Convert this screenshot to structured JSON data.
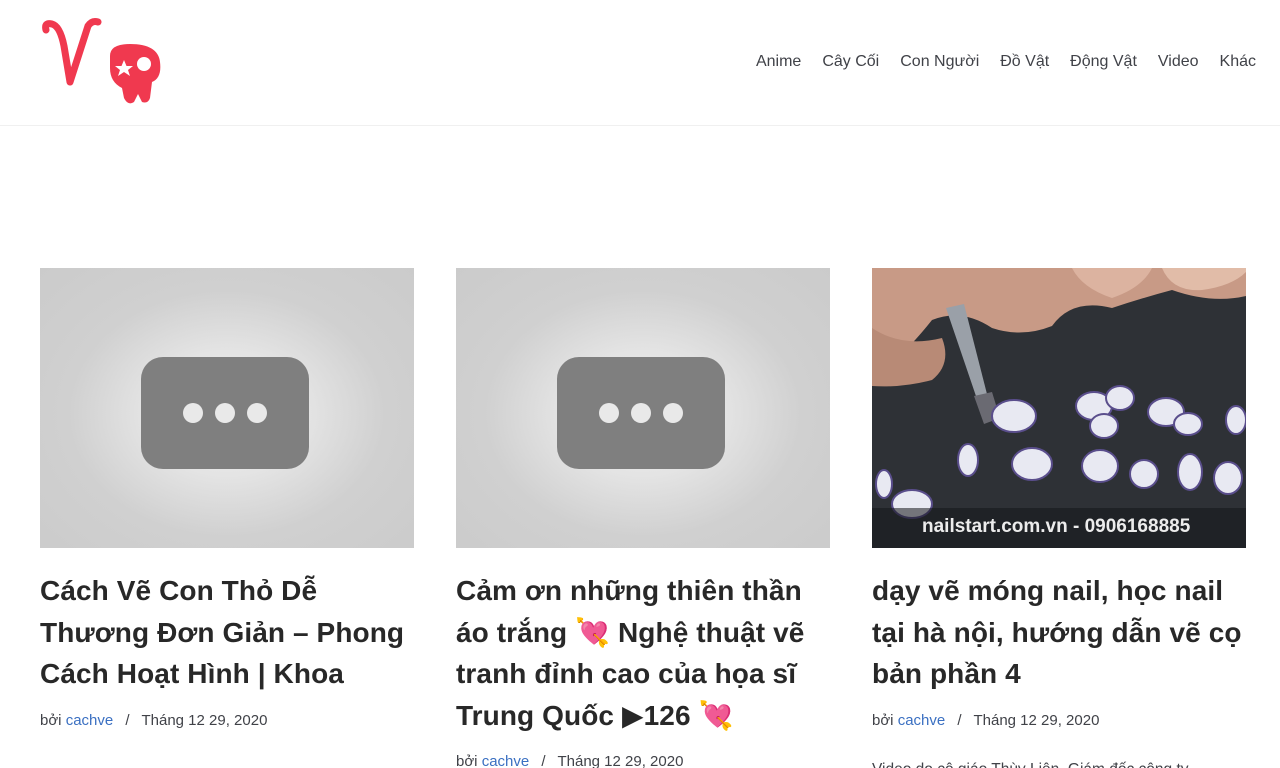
{
  "header": {
    "logo_text": "V",
    "nav": [
      "Anime",
      "Cây Cối",
      "Con Người",
      "Đồ Vật",
      "Động Vật",
      "Video",
      "Khác"
    ]
  },
  "colors": {
    "brand": "#f0394f",
    "link": "#3b70c2",
    "text": "#282828"
  },
  "posts": [
    {
      "title": "Cách Vẽ Con Thỏ Dễ Thương Đơn Giản – Phong Cách Hoạt Hình | Khoa",
      "by": "bởi",
      "author": "cachve",
      "date": "Tháng 12 29, 2020",
      "thumb": "video-placeholder"
    },
    {
      "title": "Cảm ơn những thiên thần áo trắng 💘 Nghệ thuật vẽ tranh đỉnh cao của họa sĩ Trung Quốc ▶126 💘",
      "by": "bởi",
      "author": "cachve",
      "date": "Tháng 12 29, 2020",
      "thumb": "video-placeholder"
    },
    {
      "title": "dạy vẽ móng nail, học nail tại hà nội, hướng dẫn vẽ cọ bản phần 4",
      "by": "bởi",
      "author": "cachve",
      "date": "Tháng 12 29, 2020",
      "thumb": "nail-art-photo",
      "thumb_caption": "nailstart.com.vn - 0906168885",
      "excerpt": "Video do cô giáo Thùy Liên, Giám đốc công ty"
    }
  ]
}
